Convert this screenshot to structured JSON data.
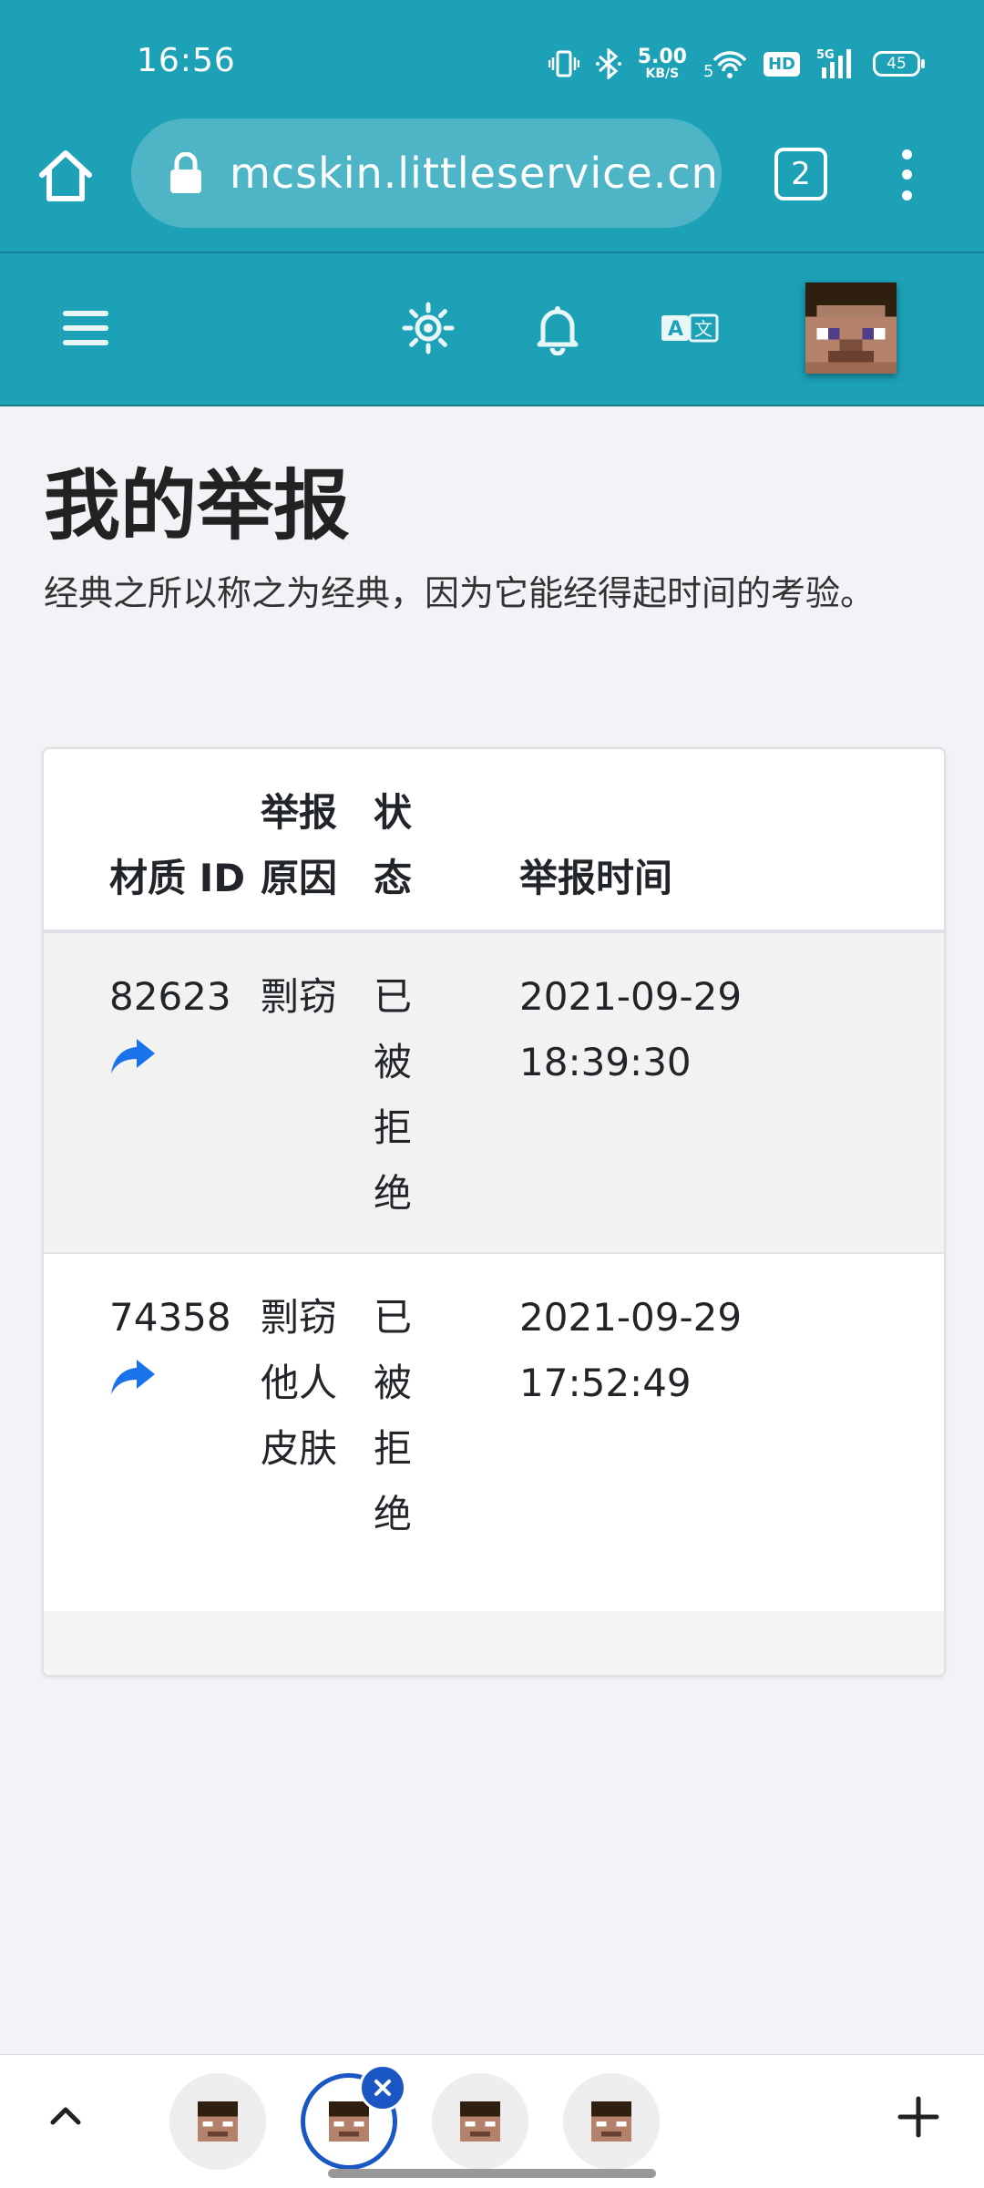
{
  "status_bar": {
    "time": "16:56",
    "net_speed": "5.00",
    "net_unit": "KB/S",
    "network_5g_label": "5G",
    "hd_label": "HD",
    "battery": "45"
  },
  "browser": {
    "url": "mcskin.littleservice.cn/",
    "tab_count": "2"
  },
  "navbar": {
    "icons": [
      "menu-icon",
      "theme-sun-icon",
      "bell-icon",
      "translate-icon",
      "avatar"
    ]
  },
  "page": {
    "title": "我的举报",
    "subtitle": "经典之所以称之为经典，因为它能经得起时间的考验。"
  },
  "table": {
    "headers": {
      "material_id": "材质 ID",
      "reason": [
        "举报",
        "原因"
      ],
      "status": [
        "状",
        "态"
      ],
      "time": "举报时间"
    },
    "rows": [
      {
        "id": "82623",
        "reason": [
          "剽窃"
        ],
        "status": [
          "已",
          "被",
          "拒",
          "绝"
        ],
        "date": "2021-09-29",
        "time": "18:39:30"
      },
      {
        "id": "74358",
        "reason": [
          "剽窃",
          "他人",
          "皮肤"
        ],
        "status": [
          "已",
          "被",
          "拒",
          "绝"
        ],
        "date": "2021-09-29",
        "time": "17:52:49"
      }
    ]
  },
  "bottom_tabs": {
    "count": 4,
    "active_index": 1
  },
  "colors": {
    "theme": "#1ca1b7",
    "link": "#1a73e8",
    "active_tab": "#1a56c4"
  }
}
